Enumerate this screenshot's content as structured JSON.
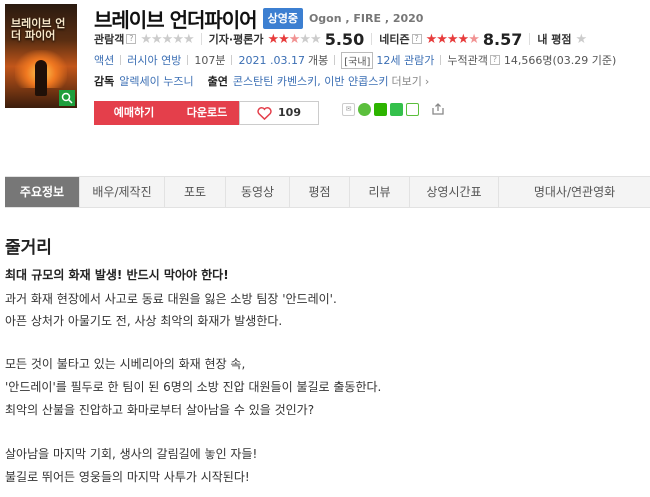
{
  "movie": {
    "poster_title": "브레이브 언더 파이어",
    "title": "브레이브 언더파이어",
    "status_badge": "상영중",
    "subtitle": "Ogon , FIRE , 2020"
  },
  "ratings": {
    "audience": {
      "label": "관람객",
      "score": null
    },
    "critics": {
      "label": "기자·평론가",
      "score": "5.50",
      "stars_filled": 2.75
    },
    "netizen": {
      "label": "네티즌",
      "score": "8.57",
      "stars_filled": 4.3
    },
    "my_rating": {
      "label": "내 평점"
    }
  },
  "info": {
    "genre": "액션",
    "country": "러시아 연방",
    "runtime": "107분",
    "release": "2021 .03.17",
    "release_suffix": "개봉",
    "grade_prefix": "[국내]",
    "grade": "12세 관람가",
    "cumulative_label": "누적관객",
    "cumulative_value": "14,566명(03.29 기준)"
  },
  "credits": {
    "director_label": "감독",
    "director": "알렉세이 누즈니",
    "cast_label": "출연",
    "cast": "콘스탄틴 카벤스키, 이반 얀콥스키",
    "more": "더보기"
  },
  "buttons": {
    "reserve": "예매하기",
    "download": "다운로드",
    "like_count": "109"
  },
  "colors": {
    "accent_red": "#e43f4b",
    "badge_blue": "#3c7fd1",
    "link_blue": "#3c6fb4"
  },
  "tabs": [
    "주요정보",
    "배우/제작진",
    "포토",
    "동영상",
    "평점",
    "리뷰",
    "상영시간표",
    "명대사/연관영화"
  ],
  "plot": {
    "heading": "줄거리",
    "lead": "최대 규모의 화재 발생! 반드시 막아야 한다!",
    "lines": [
      "과거 화재 현장에서 사고로 동료 대원을 잃은 소방 팀장 '안드레이'.",
      " 아픈 상처가 아물기도 전, 사상 최악의 화재가 발생한다.",
      "",
      "모든 것이 불타고 있는 시베리아의 화재 현장 속,",
      "'안드레이'를 필두로 한 팀이 된 6명의 소방 진압 대원들이 불길로 출동한다.",
      " 최악의 산불을 진압하고 화마로부터 살아남을 수 있을 것인가?",
      "",
      " 살아남을 마지막 기회, 생사의 갈림길에 놓인 자들!",
      " 불길로 뛰어든 영웅들의 마지막 사투가 시작된다!"
    ]
  }
}
